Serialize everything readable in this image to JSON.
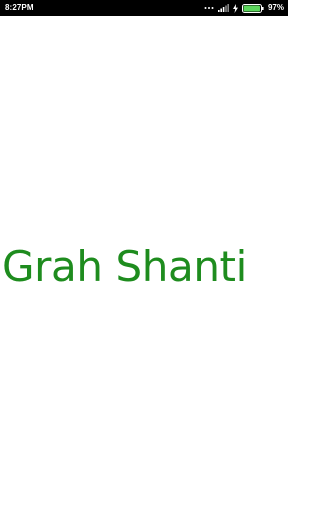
{
  "status_bar": {
    "time": "8:27PM",
    "battery_percent": "97%",
    "battery_level": 0.97,
    "icons": [
      "more-dots-icon",
      "signal-icon",
      "charging-bolt-icon",
      "battery-icon"
    ]
  },
  "splash": {
    "title": "Grah Shanti",
    "title_color": "#1e8c1e",
    "background": "#ffffff"
  }
}
